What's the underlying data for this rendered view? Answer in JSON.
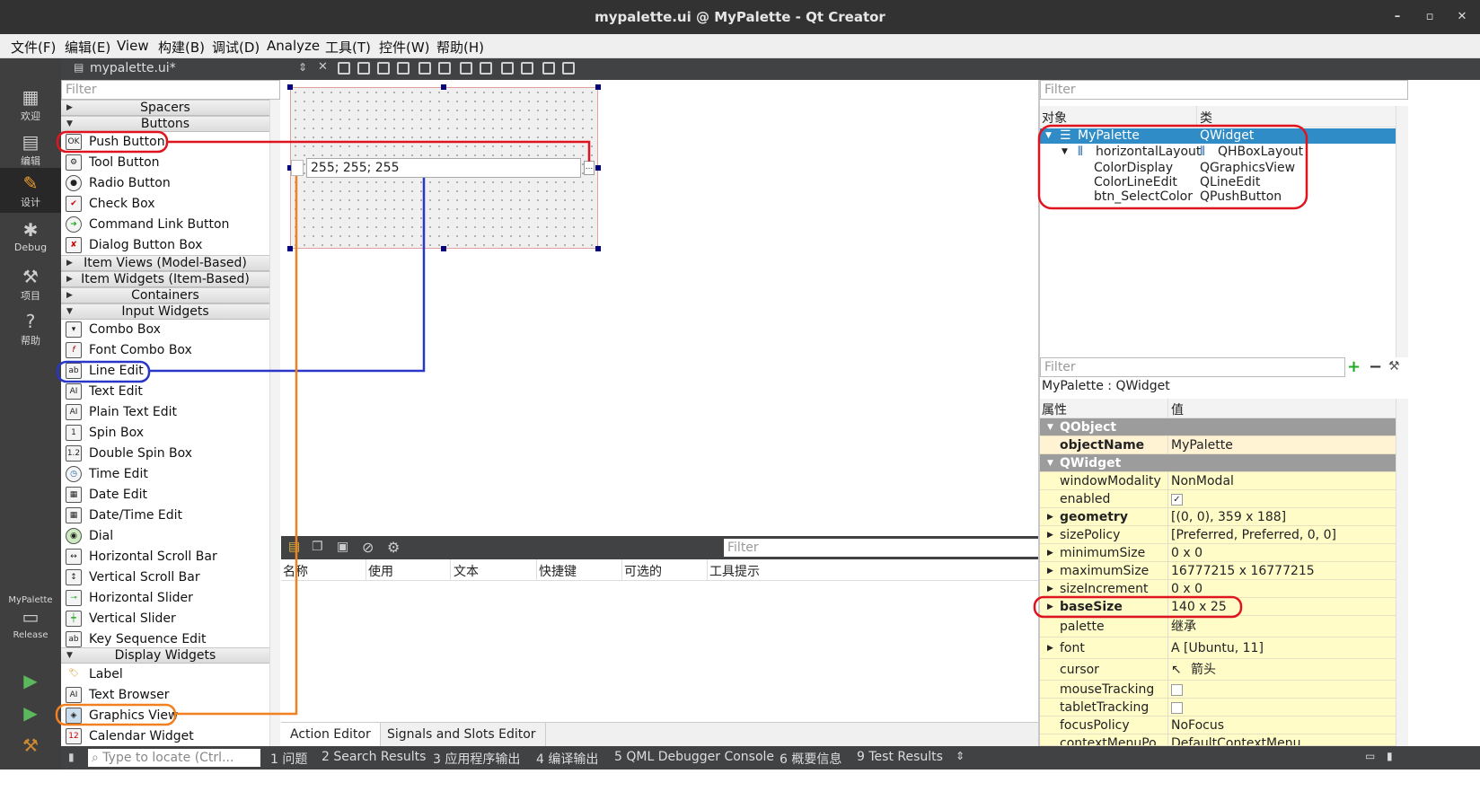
{
  "window": {
    "title": "mypalette.ui @ MyPalette - Qt Creator",
    "controls": [
      "–",
      "▫",
      "✕"
    ]
  },
  "menubar": [
    "文件(F)",
    "编辑(E)",
    "View",
    "构建(B)",
    "调试(D)",
    "Analyze",
    "工具(T)",
    "控件(W)",
    "帮助(H)"
  ],
  "modes": [
    {
      "icon": "grid-icon",
      "label": "欢迎"
    },
    {
      "icon": "edit-doc-icon",
      "label": "编辑"
    },
    {
      "icon": "pencil-icon",
      "label": "设计"
    },
    {
      "icon": "bug-icon",
      "label": "Debug"
    },
    {
      "icon": "wrench-icon",
      "label": "项目"
    },
    {
      "icon": "help-icon",
      "label": "帮助"
    }
  ],
  "kit": {
    "project": "MyPalette",
    "build": "Release"
  },
  "toolbar": {
    "file_tab": "mypalette.ui*"
  },
  "widgetbox": {
    "filter_placeholder": "Filter",
    "categories": [
      "Spacers",
      "Buttons",
      "Item Views (Model-Based)",
      "Item Widgets (Item-Based)",
      "Containers",
      "Input Widgets",
      "Display Widgets"
    ],
    "buttons": [
      "Push Button",
      "Tool Button",
      "Radio Button",
      "Check Box",
      "Command Link Button",
      "Dialog Button Box"
    ],
    "inputs": [
      "Combo Box",
      "Font Combo Box",
      "Line Edit",
      "Text Edit",
      "Plain Text Edit",
      "Spin Box",
      "Double Spin Box",
      "Time Edit",
      "Date Edit",
      "Date/Time Edit",
      "Dial",
      "Horizontal Scroll Bar",
      "Vertical Scroll Bar",
      "Horizontal Slider",
      "Vertical Slider",
      "Key Sequence Edit"
    ],
    "display": [
      "Label",
      "Text Browser",
      "Graphics View",
      "Calendar Widget"
    ]
  },
  "form": {
    "line_edit_value": "255; 255; 255",
    "select_button": "..."
  },
  "action_editor": {
    "filter": "Filter",
    "columns": [
      "名称",
      "使用",
      "文本",
      "快捷键",
      "可选的",
      "工具提示"
    ]
  },
  "editor_tabs": [
    "Action Editor",
    "Signals and Slots Editor"
  ],
  "object_inspector": {
    "filter": "Filter",
    "columns": [
      "对象",
      "类"
    ],
    "rows": [
      {
        "object": "MyPalette",
        "class": "QWidget"
      },
      {
        "object": "horizontalLayout",
        "class": "QHBoxLayout"
      },
      {
        "object": "ColorDisplay",
        "class": "QGraphicsView"
      },
      {
        "object": "ColorLineEdit",
        "class": "QLineEdit"
      },
      {
        "object": "btn_SelectColor",
        "class": "QPushButton"
      }
    ]
  },
  "property_editor": {
    "filter": "Filter",
    "class_label": "MyPalette : QWidget",
    "columns": [
      "属性",
      "值"
    ],
    "sections": [
      "QObject",
      "QWidget"
    ],
    "rows": [
      {
        "name": "objectName",
        "value": "MyPalette"
      },
      {
        "name": "windowModality",
        "value": "NonModal"
      },
      {
        "name": "enabled",
        "value": "✓"
      },
      {
        "name": "geometry",
        "value": "[(0, 0), 359 x 188]"
      },
      {
        "name": "sizePolicy",
        "value": "[Preferred, Preferred, 0, 0]"
      },
      {
        "name": "minimumSize",
        "value": "0 x 0"
      },
      {
        "name": "maximumSize",
        "value": "16777215 x 16777215"
      },
      {
        "name": "sizeIncrement",
        "value": "0 x 0"
      },
      {
        "name": "baseSize",
        "value": "140 x 25"
      },
      {
        "name": "palette",
        "value": "继承"
      },
      {
        "name": "font",
        "value": "A  [Ubuntu, 11]"
      },
      {
        "name": "cursor",
        "value": "箭头"
      },
      {
        "name": "mouseTracking",
        "value": ""
      },
      {
        "name": "tabletTracking",
        "value": ""
      },
      {
        "name": "focusPolicy",
        "value": "NoFocus"
      },
      {
        "name": "contextMenuPo...",
        "value": "DefaultContextMenu"
      }
    ]
  },
  "statusbar": {
    "locate_placeholder": "Type to locate (Ctrl...",
    "panes": [
      "1 问题",
      "2 Search Results",
      "3 应用程序输出",
      "4 编译输出",
      "5 QML Debugger Console",
      "6 概要信息",
      "9 Test Results"
    ]
  },
  "colors": {
    "annotation_red": "#e0141e",
    "annotation_blue": "#2a36c8",
    "annotation_orange": "#f08020",
    "selection": "#308cc6"
  }
}
